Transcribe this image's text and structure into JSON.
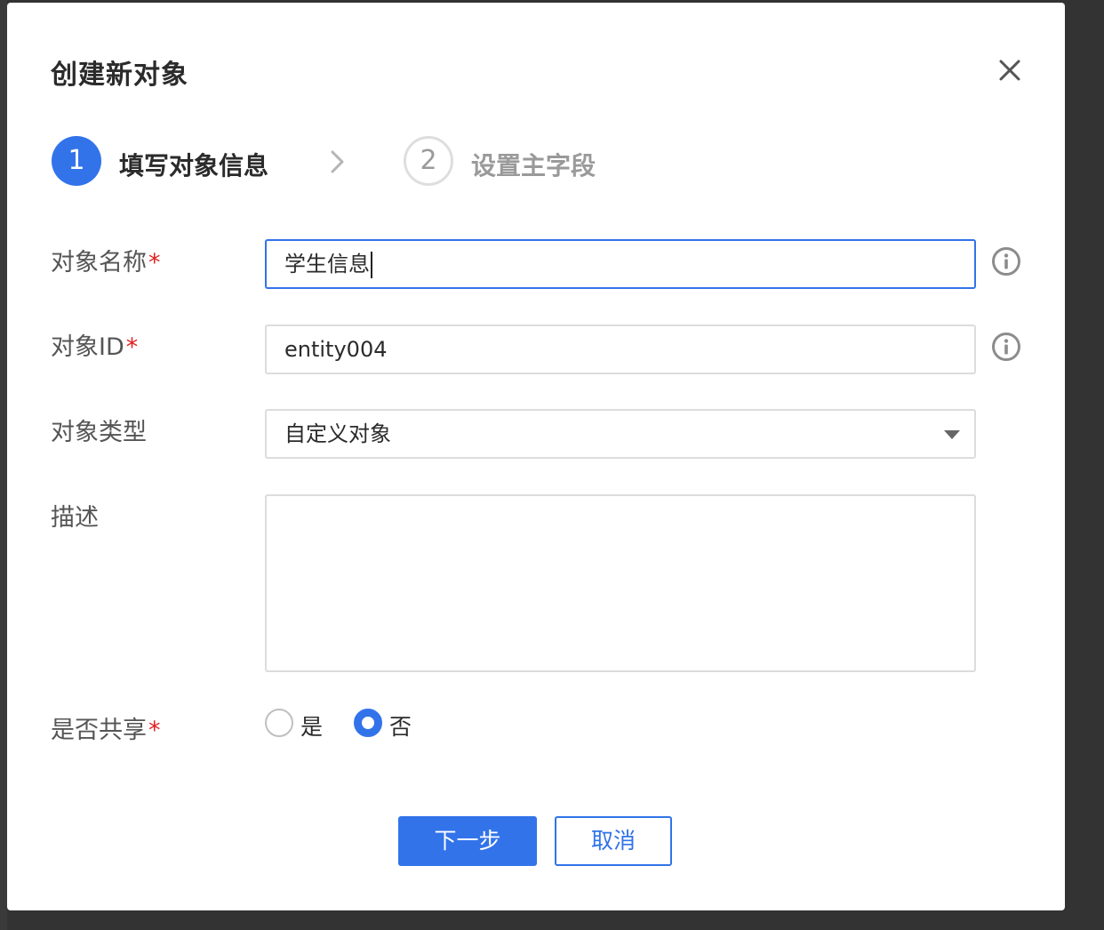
{
  "dialog": {
    "title": "创建新对象",
    "close_icon": "close-icon"
  },
  "steps": [
    {
      "number": "1",
      "label": "填写对象信息",
      "state": "active"
    },
    {
      "number": "2",
      "label": "设置主字段",
      "state": "pending"
    }
  ],
  "form": {
    "name": {
      "label": "对象名称",
      "required_mark": "*",
      "value": "学生信息",
      "info_icon": "info-icon"
    },
    "id": {
      "label": "对象ID",
      "required_mark": "*",
      "value": "entity004",
      "info_icon": "info-icon"
    },
    "type": {
      "label": "对象类型",
      "value": "自定义对象",
      "arrow_icon": "caret-down-icon"
    },
    "description": {
      "label": "描述",
      "value": ""
    },
    "shared": {
      "label": "是否共享",
      "required_mark": "*",
      "options": [
        {
          "label": "是",
          "selected": false
        },
        {
          "label": "否",
          "selected": true
        }
      ]
    }
  },
  "actions": {
    "next_label": "下一步",
    "cancel_label": "取消"
  },
  "colors": {
    "primary": "#3273ea",
    "required": "#e02020",
    "overlay": "#333333"
  }
}
